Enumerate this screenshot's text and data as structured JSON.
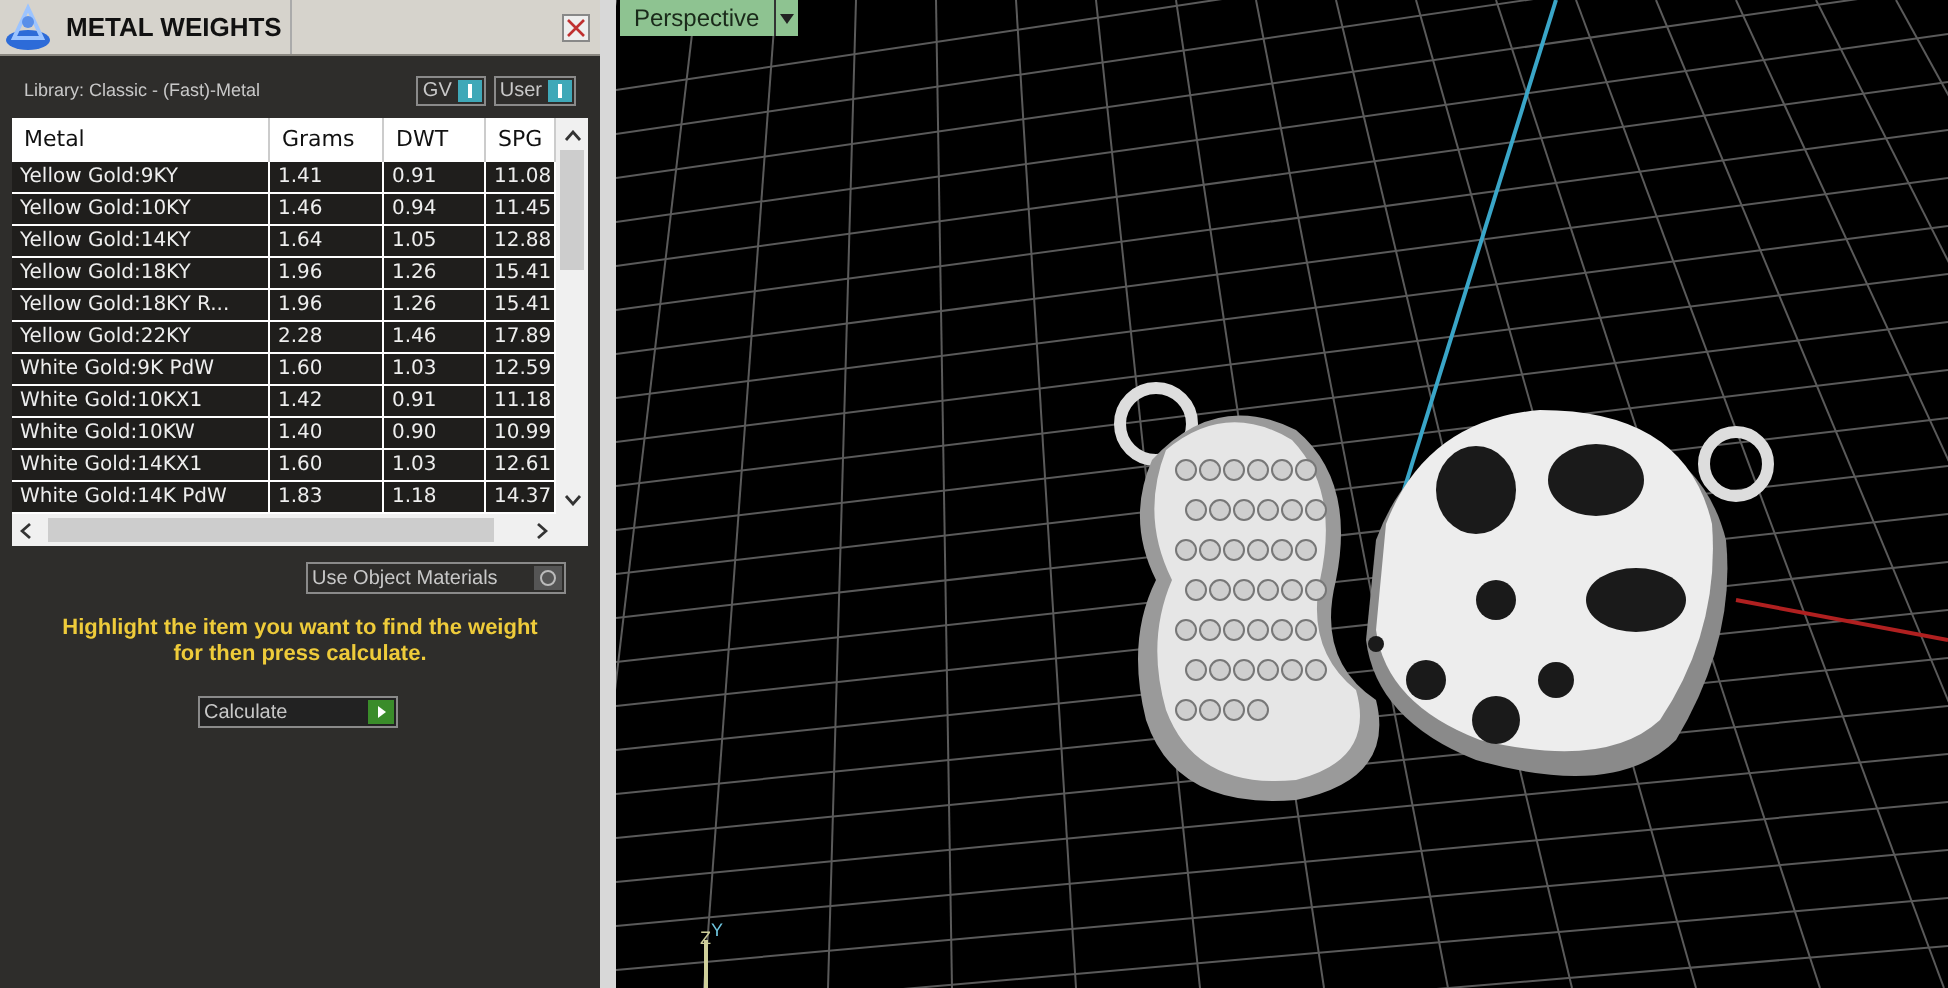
{
  "panel": {
    "title": "METAL WEIGHTS",
    "library": "Library: Classic - (Fast)-Metal",
    "toggles": [
      {
        "label": "GV",
        "on": true
      },
      {
        "label": "User",
        "on": true
      }
    ],
    "table": {
      "columns": [
        "Metal",
        "Grams",
        "DWT",
        "SPG"
      ],
      "rows": [
        {
          "cells": [
            "Yellow Gold:9KY",
            "1.41",
            "0.91",
            "11.08"
          ],
          "selected": false
        },
        {
          "cells": [
            "Yellow Gold:10KY",
            "1.46",
            "0.94",
            "11.45"
          ],
          "selected": false
        },
        {
          "cells": [
            "Yellow Gold:14KY",
            "1.64",
            "1.05",
            "12.88"
          ],
          "selected": false
        },
        {
          "cells": [
            "Yellow Gold:18KY",
            "1.96",
            "1.26",
            "15.41"
          ],
          "selected": false
        },
        {
          "cells": [
            "Yellow Gold:18KY R...",
            "1.96",
            "1.26",
            "15.41"
          ],
          "selected": false
        },
        {
          "cells": [
            "Yellow Gold:22KY",
            "2.28",
            "1.46",
            "17.89"
          ],
          "selected": false
        },
        {
          "cells": [
            "White Gold:9K PdW",
            "1.60",
            "1.03",
            "12.59"
          ],
          "selected": false
        },
        {
          "cells": [
            "White Gold:10KX1",
            "1.42",
            "0.91",
            "11.18"
          ],
          "selected": false
        },
        {
          "cells": [
            "White Gold:10KW",
            "1.40",
            "0.90",
            "10.99"
          ],
          "selected": false
        },
        {
          "cells": [
            "White Gold:14KX1",
            "1.60",
            "1.03",
            "12.61"
          ],
          "selected": false
        },
        {
          "cells": [
            "White Gold:14K PdW",
            "1.83",
            "1.18",
            "14.37"
          ],
          "selected": false
        }
      ]
    },
    "use_object_materials": {
      "label": "Use Object Materials",
      "checked": false
    },
    "hint": "Highlight the item you want to find the weight for then press calculate.",
    "calculate_button": "Calculate"
  },
  "viewport": {
    "view_menu": "Perspective",
    "axis_labels": [
      "Z",
      "Y"
    ]
  }
}
